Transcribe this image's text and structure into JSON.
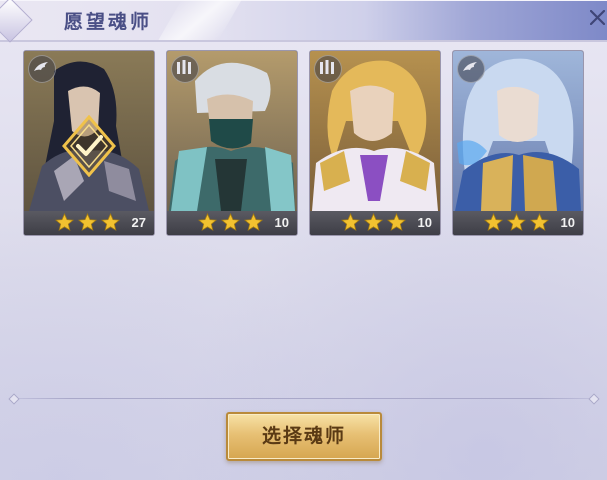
{
  "header": {
    "title": "愿望魂师",
    "close_icon": "close-icon"
  },
  "cards": [
    {
      "name": "soul-master-1",
      "stars": 3,
      "level": "27",
      "selected": true,
      "badge_icon": "wing-icon"
    },
    {
      "name": "soul-master-2",
      "stars": 3,
      "level": "10",
      "selected": false,
      "badge_icon": "banner-icon"
    },
    {
      "name": "soul-master-3",
      "stars": 3,
      "level": "10",
      "selected": false,
      "badge_icon": "banner-icon"
    },
    {
      "name": "soul-master-4",
      "stars": 3,
      "level": "10",
      "selected": false,
      "badge_icon": "wing-icon"
    }
  ],
  "footer": {
    "select_label": "选择魂师"
  },
  "colors": {
    "title": "#4a4f86",
    "star": "#f2c230",
    "button_gold": "#e7c074",
    "button_text": "#5a3a14"
  }
}
